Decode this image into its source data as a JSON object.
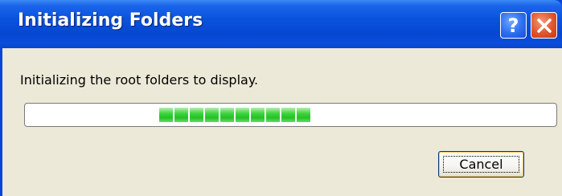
{
  "window": {
    "title": "Initializing Folders",
    "help_glyph": "?",
    "icons": {
      "help": "help-icon",
      "close": "close-icon"
    }
  },
  "body": {
    "message": "Initializing the root folders to display.",
    "progress": {
      "style": "marquee",
      "block_count": 10,
      "color": "#2fc42f"
    }
  },
  "buttons": {
    "cancel_label": "Cancel"
  },
  "colors": {
    "titlebar": "#0a52dc",
    "dialog_bg": "#ece9d8",
    "close_btn": "#e2542a"
  }
}
